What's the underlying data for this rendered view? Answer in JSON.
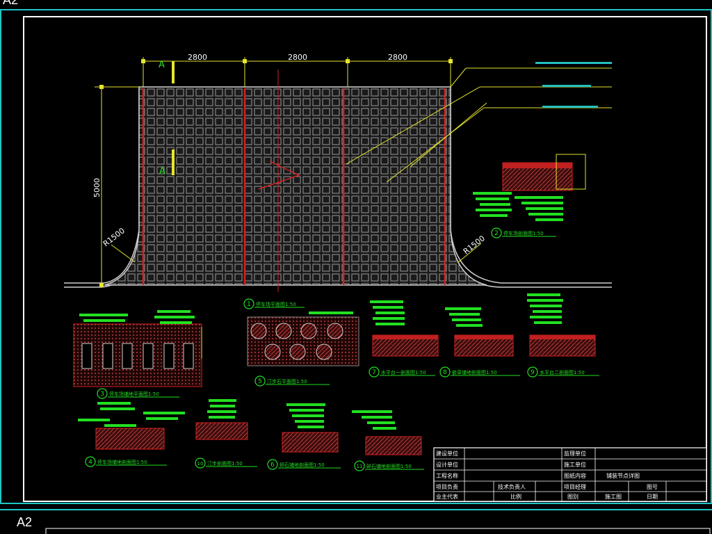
{
  "sheet": {
    "top_label": "A2",
    "bottom_label": "A2"
  },
  "plan": {
    "dimensions": [
      "2800",
      "2800",
      "2800"
    ],
    "height_dim": "5000",
    "radius_left": "R1500",
    "radius_right": "R1500",
    "section_mark": "A"
  },
  "details": [
    {
      "num": "1",
      "caption": "停车场平面图1:50"
    },
    {
      "num": "2",
      "caption": "停车场剖面图1:50"
    },
    {
      "num": "3",
      "caption": "停车场铺地平面图1:50"
    },
    {
      "num": "4",
      "caption": "停车场铺地剖面图1:50"
    },
    {
      "num": "5",
      "caption": "汀步石平面图1:50"
    },
    {
      "num": "6",
      "caption": "卵石铺地剖面图1:50"
    },
    {
      "num": "7",
      "caption": "水平台一剖面图1:50"
    },
    {
      "num": "8",
      "caption": "嵌草铺地剖面图1:50"
    },
    {
      "num": "9",
      "caption": "水平台二剖面图1:50"
    },
    {
      "num": "10",
      "caption": "汀步剖面图1:50"
    },
    {
      "num": "11",
      "caption": "碎石铺地剖面图1:50"
    }
  ],
  "title_block": {
    "rows": [
      [
        "建设单位",
        "",
        "监理单位",
        ""
      ],
      [
        "设计单位",
        "",
        "施工单位",
        ""
      ],
      [
        "工程名称",
        "",
        "图纸内容",
        "铺装节点详图"
      ],
      [
        "项目负责",
        "技术负责人",
        "项目经理",
        "图号"
      ],
      [
        "业主代表",
        "比例",
        "图别",
        "施工图",
        "日期"
      ]
    ]
  },
  "colors": {
    "frame": "#ffffff",
    "cyan": "#1fc6c6",
    "yellow": "#e5e52e",
    "green": "#22e022",
    "red": "#d42020",
    "grid": "#8a8a8a"
  }
}
